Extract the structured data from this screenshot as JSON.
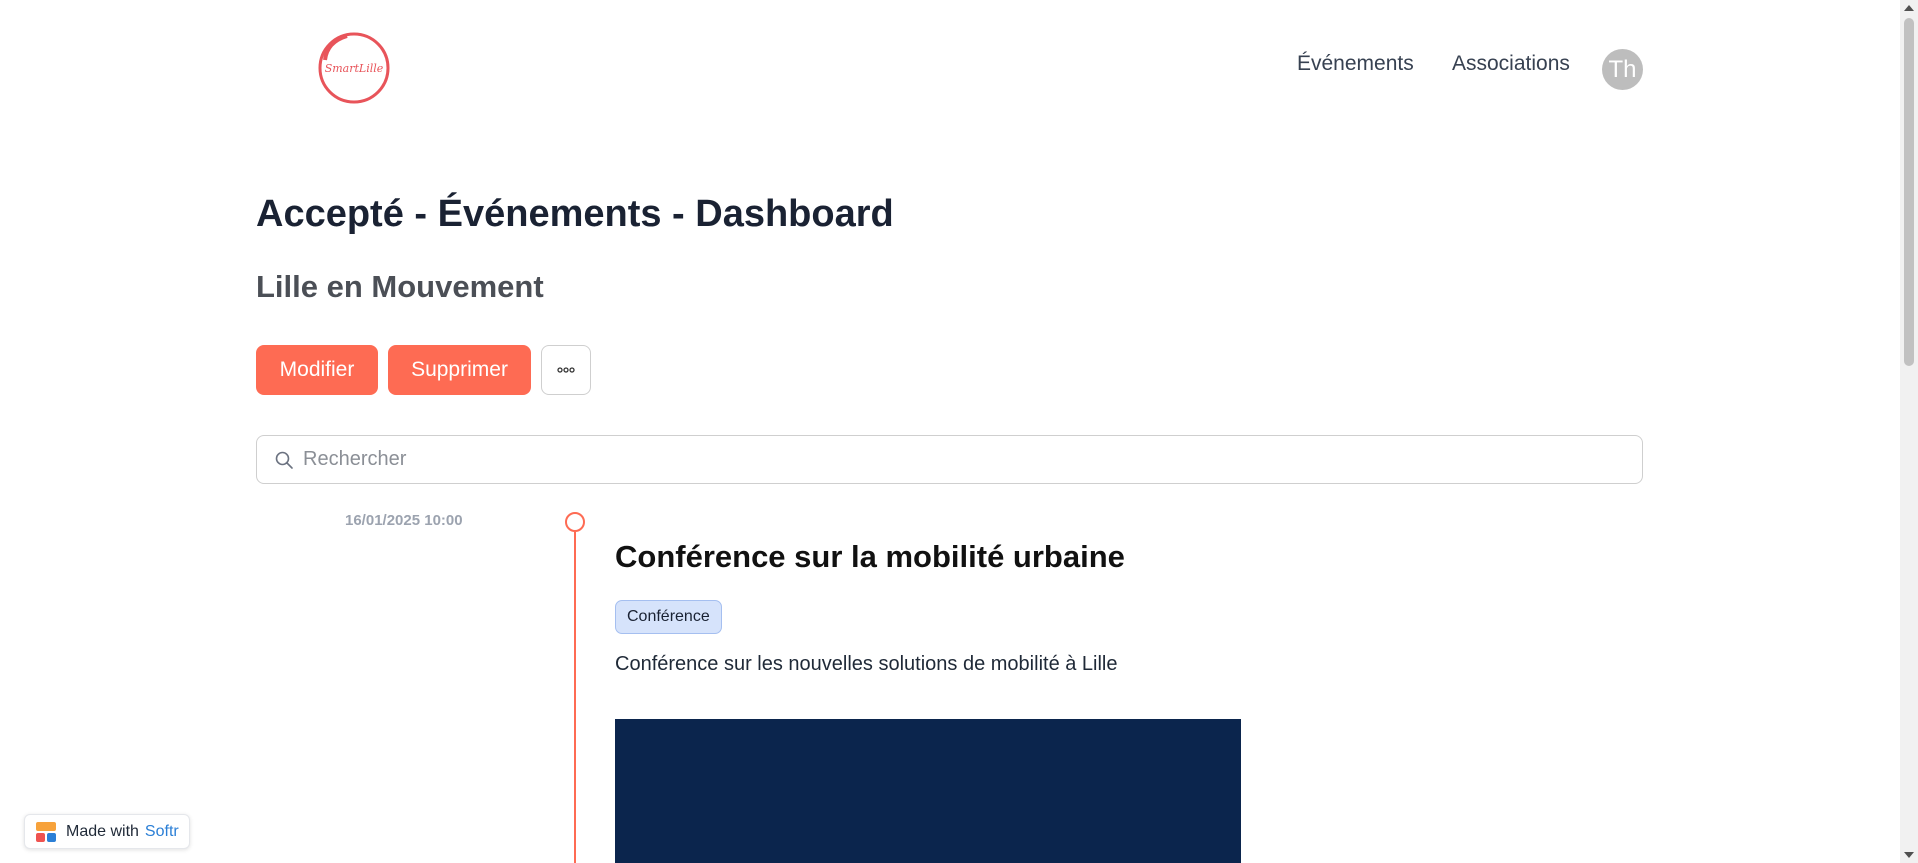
{
  "header": {
    "logo_text": "SmartLille",
    "nav": [
      "Événements",
      "Associations"
    ],
    "avatar_initials": "Th"
  },
  "page": {
    "title": "Accepté - Événements - Dashboard",
    "subtitle": "Lille en Mouvement"
  },
  "actions": {
    "modify_label": "Modifier",
    "delete_label": "Supprimer",
    "more_icon": "more-horizontal-icon"
  },
  "search": {
    "placeholder": "Rechercher",
    "value": "",
    "icon": "search-icon"
  },
  "timeline": {
    "items": [
      {
        "date": "16/01/2025 10:00",
        "title": "Conférence sur la mobilité urbaine",
        "tag": "Conférence",
        "description": "Conférence sur les nouvelles solutions de mobilité à Lille"
      }
    ]
  },
  "footer_badge": {
    "made_with": "Made with",
    "brand": "Softr"
  },
  "colors": {
    "accent": "#fe6b53",
    "title": "#1a2233",
    "tag_bg": "#d6e3fb",
    "image_bg": "#0b254d",
    "softr_blue": "#2b7fd6"
  }
}
